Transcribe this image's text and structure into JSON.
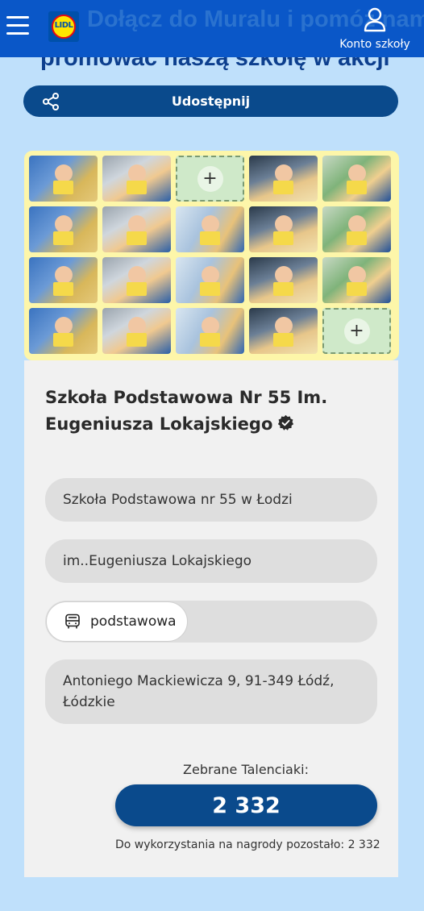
{
  "header": {
    "menu_icon": "hamburger-icon",
    "logo_text": "LIDL",
    "title_partial": "Dołącz do Muralu i pomóż nam",
    "account_icon": "user-icon",
    "account_label": "Konto szkoły"
  },
  "subtitle": "promować naszą szkołę w akcji",
  "share": {
    "label": "Udostępnij",
    "icon": "share-icon"
  },
  "mural": {
    "cells": [
      "photo",
      "photo",
      "add",
      "photo",
      "photo",
      "photo",
      "photo",
      "photo",
      "photo",
      "photo",
      "photo",
      "photo",
      "photo",
      "photo",
      "photo",
      "photo",
      "photo",
      "photo",
      "photo",
      "add"
    ]
  },
  "school": {
    "name": "Szkoła Podstawowa Nr 55 Im. Eugeniusza Lokajskiego",
    "verified_icon": "verified-badge-icon",
    "field_name": "Szkoła Podstawowa nr 55 w Łodzi",
    "field_patron": "im..Eugeniusza Lokajskiego",
    "type": "podstawowa",
    "type_icon": "bus-icon",
    "address": "Antoniego Mackiewicza 9, 91-349 Łódź, Łódzkie"
  },
  "points": {
    "label": "Zebrane Talenciaki:",
    "value": "2 332",
    "remaining": "Do wykorzystania na nagrody pozostało: 2 332"
  },
  "colors": {
    "brand_blue": "#0a57c8",
    "dark_button": "#0a4a8c",
    "mural_bg": "#fdf6a9",
    "page_bg": "#bfe0fb"
  }
}
